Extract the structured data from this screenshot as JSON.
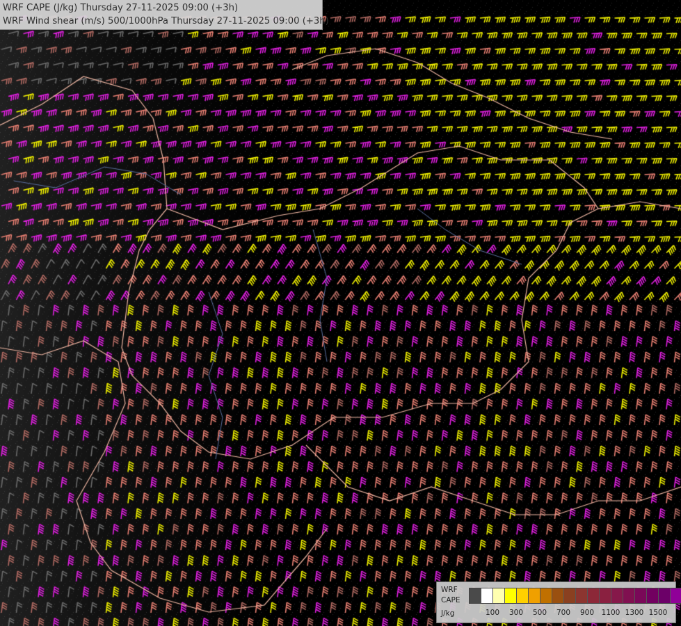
{
  "title": {
    "line1": "WRF CAPE (J/kg) Thursday 27-11-2025 09:00 (+3h)",
    "line2": "WRF Wind shear (m/s) 500/1000hPa Thursday 27-11-2025 09:00 (+3h)"
  },
  "legend": {
    "label_line1": "WRF",
    "label_line2": "CAPE",
    "label_line3": "J/kg",
    "colors": [
      "#4a4a4a",
      "#ffffff",
      "#ffffb0",
      "#ffff00",
      "#ffd000",
      "#f0a000",
      "#c07000",
      "#9a5010",
      "#8a4020",
      "#8c3530",
      "#8c2838",
      "#8a2040",
      "#86184a",
      "#801050",
      "#7a0858",
      "#720060",
      "#6c0068",
      "#900098"
    ],
    "ticks": [
      "100",
      "300",
      "500",
      "700",
      "900",
      "1100",
      "1300",
      "1500"
    ]
  },
  "map": {
    "background": "#000000",
    "barb_colors": {
      "grey": "#6b6b6b",
      "salmon": "#e87f72",
      "magenta": "#e020e0",
      "yellow": "#f0f000",
      "dark_salmon": "#b26a62"
    },
    "border_color": "#f2b8a4",
    "river_color": "#5a6fa0"
  }
}
